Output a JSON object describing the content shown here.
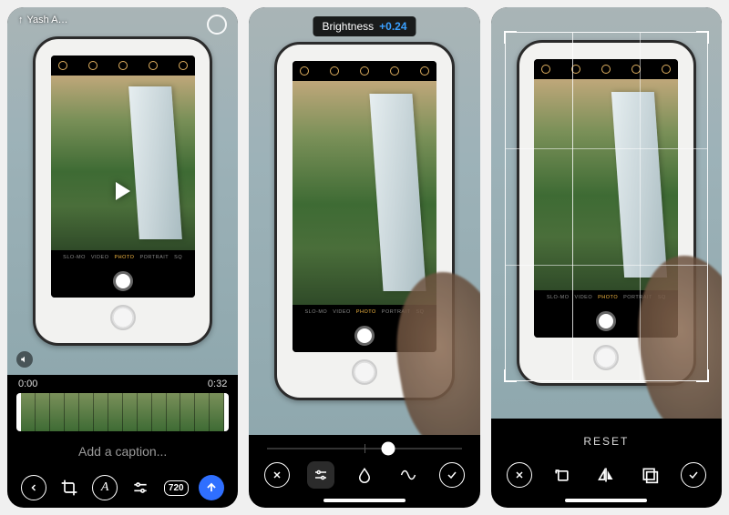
{
  "panel1": {
    "user_label": "Yash A…",
    "time_start": "0:00",
    "time_end": "0:32",
    "caption_placeholder": "Add a caption...",
    "resolution_badge": "720",
    "camera_modes": [
      "SLO-MO",
      "VIDEO",
      "PHOTO",
      "PORTRAIT",
      "SQ"
    ]
  },
  "panel2": {
    "adjust_label": "Brightness",
    "adjust_value": "+0.24",
    "slider_position_pct": 62,
    "camera_modes": [
      "SLO-MO",
      "VIDEO",
      "PHOTO",
      "PORTRAIT",
      "SQ"
    ]
  },
  "panel3": {
    "reset_label": "RESET",
    "camera_modes": [
      "SLO-MO",
      "VIDEO",
      "PHOTO",
      "PORTRAIT",
      "SQ"
    ]
  },
  "colors": {
    "accent_blue": "#2f6fff",
    "value_blue": "#3aa0ff",
    "mode_gold": "#f5b842"
  }
}
